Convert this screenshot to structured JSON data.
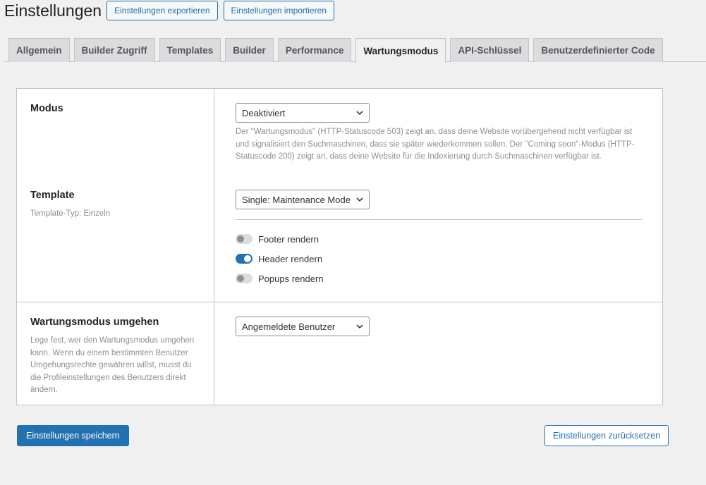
{
  "header": {
    "title": "Einstellungen",
    "export_label": "Einstellungen exportieren",
    "import_label": "Einstellungen importieren"
  },
  "tabs": [
    {
      "label": "Allgemein",
      "active": false
    },
    {
      "label": "Builder Zugriff",
      "active": false
    },
    {
      "label": "Templates",
      "active": false
    },
    {
      "label": "Builder",
      "active": false
    },
    {
      "label": "Performance",
      "active": false
    },
    {
      "label": "Wartungsmodus",
      "active": true
    },
    {
      "label": "API-Schlüssel",
      "active": false
    },
    {
      "label": "Benutzerdefinierter Code",
      "active": false
    }
  ],
  "modus": {
    "label": "Modus",
    "value": "Deaktiviert",
    "description": "Der \"Wartungsmodus\" (HTTP-Statuscode 503) zeigt an, dass deine Website vorübergehend nicht verfügbar ist und signalisiert den Suchmaschinen, dass sie später wiederkommen sollen. Der \"Coming soon\"-Modus (HTTP-Statuscode 200) zeigt an, dass deine Website für die Indexierung durch Suchmaschinen verfügbar ist."
  },
  "template": {
    "label": "Template",
    "sub": "Template-Typ: Einzeln",
    "value": "Single: Maintenance Mode",
    "toggles": [
      {
        "label": "Footer rendern",
        "on": false
      },
      {
        "label": "Header rendern",
        "on": true
      },
      {
        "label": "Popups rendern",
        "on": false
      }
    ]
  },
  "bypass": {
    "label": "Wartungsmodus umgehen",
    "description": "Lege fest, wer den Wartungsmodus umgehen kann. Wenn du einem bestimmten Benutzer Umgehungsrechte gewähren willst, musst du die Profileinstellungen des Benutzers direkt ändern.",
    "value": "Angemeldete Benutzer"
  },
  "footer": {
    "save_label": "Einstellungen speichern",
    "reset_label": "Einstellungen zurücksetzen"
  },
  "colors": {
    "accent": "#2271b1",
    "background": "#f0f0f1"
  }
}
